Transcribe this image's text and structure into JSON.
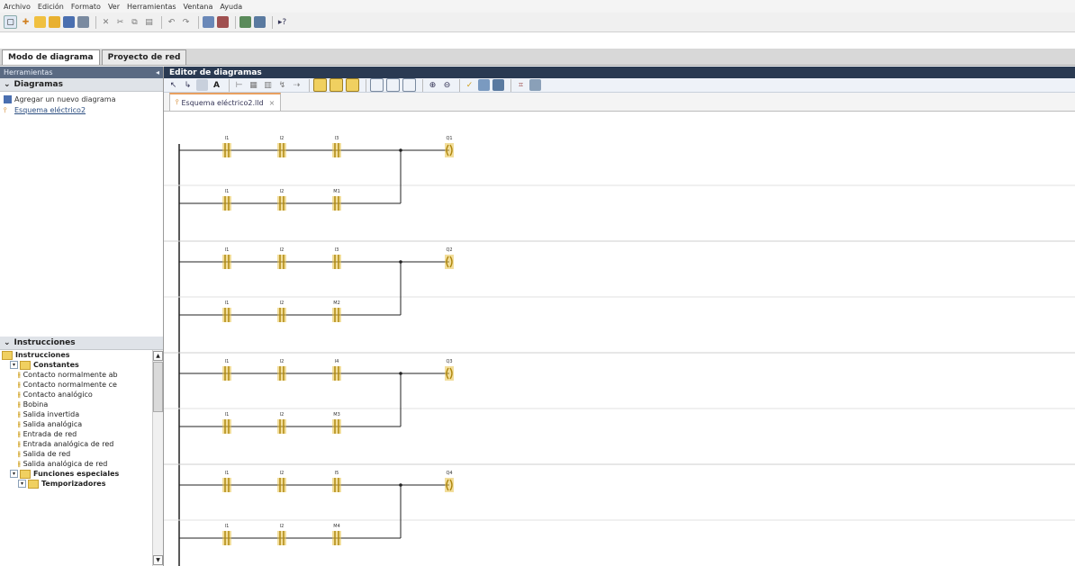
{
  "menu": [
    "Archivo",
    "Edición",
    "Formato",
    "Ver",
    "Herramientas",
    "Ventana",
    "Ayuda"
  ],
  "modes": {
    "diagram": "Modo de diagrama",
    "network": "Proyecto de red"
  },
  "left": {
    "tools_title": "Herramientas",
    "diagrams_header": "Diagramas",
    "diagram_items": [
      "Agregar un nuevo diagrama",
      "Esquema eléctrico2"
    ],
    "instructions_header": "Instrucciones",
    "tree": [
      {
        "label": "Instrucciones",
        "level": 0,
        "kind": "folder"
      },
      {
        "label": "Constantes",
        "level": 1,
        "kind": "folder"
      },
      {
        "label": "Contacto normalmente ab",
        "level": 2,
        "kind": "item"
      },
      {
        "label": "Contacto normalmente ce",
        "level": 2,
        "kind": "item"
      },
      {
        "label": "Contacto analógico",
        "level": 2,
        "kind": "item"
      },
      {
        "label": "Bobina",
        "level": 2,
        "kind": "item"
      },
      {
        "label": "Salida invertida",
        "level": 2,
        "kind": "item"
      },
      {
        "label": "Salida analógica",
        "level": 2,
        "kind": "item"
      },
      {
        "label": "Entrada de red",
        "level": 2,
        "kind": "item"
      },
      {
        "label": "Entrada analógica de red",
        "level": 2,
        "kind": "item"
      },
      {
        "label": "Salida de red",
        "level": 2,
        "kind": "item"
      },
      {
        "label": "Salida analógica de red",
        "level": 2,
        "kind": "item"
      },
      {
        "label": "Funciones especiales",
        "level": 1,
        "kind": "folder"
      },
      {
        "label": "Temporizadores",
        "level": 2,
        "kind": "folder"
      }
    ]
  },
  "editor": {
    "title": "Editor de diagramas",
    "doc_tab": "Esquema eléctrico2.lld"
  },
  "rungs": [
    {
      "c1": "I1",
      "c2": "I2",
      "c3": "I3",
      "c3b": "M1",
      "coil": "Q1"
    },
    {
      "c1": "I1",
      "c2": "I2",
      "c3": "I3",
      "c3b": "M2",
      "coil": "Q2"
    },
    {
      "c1": "I1",
      "c2": "I2",
      "c3": "I4",
      "c3b": "M3",
      "coil": "Q3"
    },
    {
      "c1": "I1",
      "c2": "I2",
      "c3": "I5",
      "c3b": "M4",
      "coil": "Q4"
    }
  ],
  "colors": {
    "contact": "#e8c34a",
    "title_bar": "#2a3a52",
    "panel_title": "#5a6a82"
  }
}
